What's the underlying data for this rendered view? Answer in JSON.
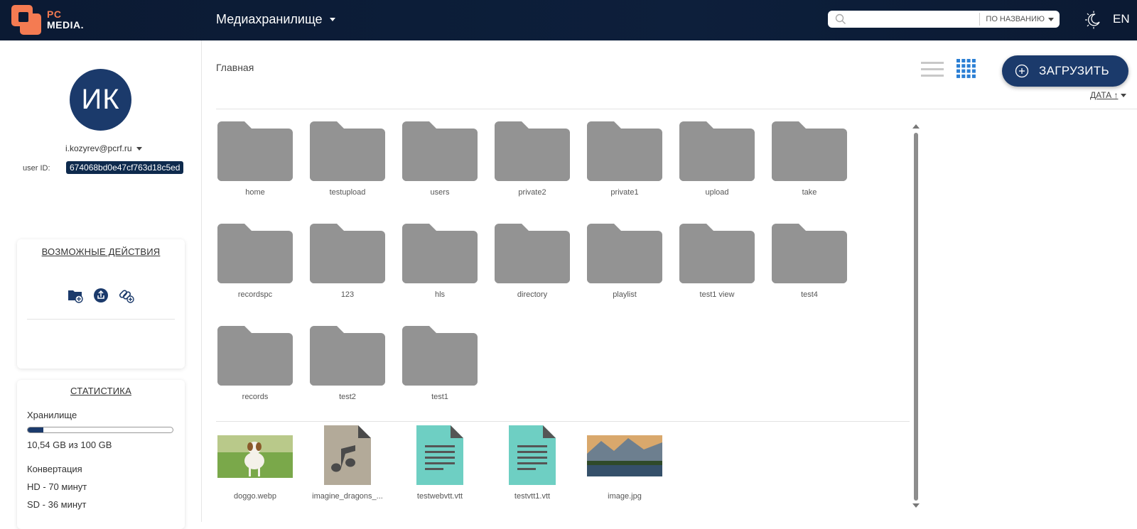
{
  "header": {
    "logo_top": "PC",
    "logo_bottom": "MEDIA.",
    "section_title": "Медиахранилище",
    "search_placeholder": "",
    "sort_by": "ПО НАЗВАНИЮ",
    "language": "EN",
    "accent": "#f47b52"
  },
  "sidebar": {
    "avatar_initials": "ИК",
    "email": "i.kozyrev@pcrf.ru",
    "user_id_label": "user ID:",
    "user_id": "674068bd0e47cf763d18c5ed",
    "actions_title": "ВОЗМОЖНЫЕ ДЕЙСТВИЯ",
    "actions": [
      "folder-add-icon",
      "upload-share-icon",
      "link-add-icon"
    ],
    "stats_title": "СТАТИСТИКА",
    "storage_label": "Хранилище",
    "storage_value": "10,54 GB из 100 GB",
    "storage_fraction": 0.1054,
    "conversion_label": "Конвертация",
    "hd_value": "HD - 70 минут",
    "sd_value": "SD - 36 минут"
  },
  "main": {
    "breadcrumb": "Главная",
    "upload_label": "ЗАГРУЗИТЬ",
    "sort_label": "ДАТА ↑",
    "folders": [
      "home",
      "testupload",
      "users",
      "private2",
      "private1",
      "upload",
      "take",
      "recordspc",
      "123",
      "hls",
      "directory",
      "playlist",
      "test1 view",
      "test4",
      "records",
      "test2",
      "test1"
    ],
    "files": [
      {
        "name": "doggo.webp",
        "kind": "image-dog"
      },
      {
        "name": "imagine_dragons_...",
        "kind": "audio"
      },
      {
        "name": "testwebvtt.vtt",
        "kind": "text"
      },
      {
        "name": "testvtt1.vtt",
        "kind": "text"
      },
      {
        "name": "image.jpg",
        "kind": "image-landscape"
      }
    ]
  }
}
